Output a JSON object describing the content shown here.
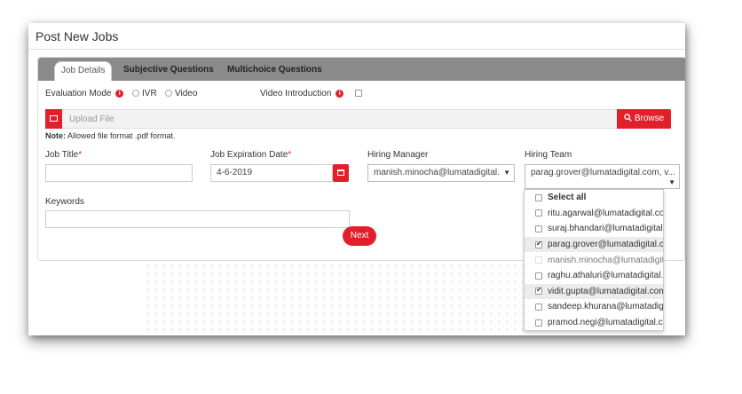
{
  "page": {
    "title": "Post New Jobs"
  },
  "tabs": [
    {
      "label": "Job Details",
      "active": true
    },
    {
      "label": "Subjective Questions",
      "active": false
    },
    {
      "label": "Multichoice Questions",
      "active": false
    }
  ],
  "evaluation": {
    "label": "Evaluation Mode",
    "options": [
      "IVR",
      "Video"
    ],
    "video_intro_label": "Video Introduction",
    "info_glyph": "i"
  },
  "upload": {
    "placeholder": "Upload File",
    "browse_label": "Browse"
  },
  "note": {
    "bold": "Note:",
    "text": " Allowed file format .pdf format."
  },
  "fields": {
    "job_title": {
      "label": "Job Title",
      "required_mark": "*",
      "value": ""
    },
    "job_expiration": {
      "label": "Job Expiration Date",
      "required_mark": "*",
      "value": "4-6-2019"
    },
    "hiring_manager": {
      "label": "Hiring Manager",
      "value": "manish.minocha@lumatadigital."
    },
    "hiring_team": {
      "label": "Hiring Team",
      "value": "parag.grover@lumatadigital.com, v..."
    },
    "keywords": {
      "label": "Keywords",
      "value": ""
    }
  },
  "next_label": "Next",
  "hiring_team_options": [
    {
      "label": "Select all",
      "checked": false,
      "bold": true
    },
    {
      "label": "ritu.agarwal@lumatadigital.com",
      "checked": false
    },
    {
      "label": "suraj.bhandari@lumatadigital.com",
      "checked": false
    },
    {
      "label": "parag.grover@lumatadigital.com",
      "checked": true
    },
    {
      "label": "manish.minocha@lumatadigital.com",
      "checked": false,
      "disabled": true
    },
    {
      "label": "raghu.athaluri@lumatadigital.com",
      "checked": false
    },
    {
      "label": "vidit.gupta@lumatadigital.com",
      "checked": true
    },
    {
      "label": "sandeep.khurana@lumatadigital.com",
      "checked": false
    },
    {
      "label": "pramod.negi@lumatadigital.com",
      "checked": false
    }
  ],
  "icons": {
    "upload": "image-icon",
    "browse": "search-icon",
    "calendar": "calendar-icon",
    "info": "info-icon"
  },
  "colors": {
    "accent": "#e2202c",
    "tabbar": "#8a8a8a"
  }
}
